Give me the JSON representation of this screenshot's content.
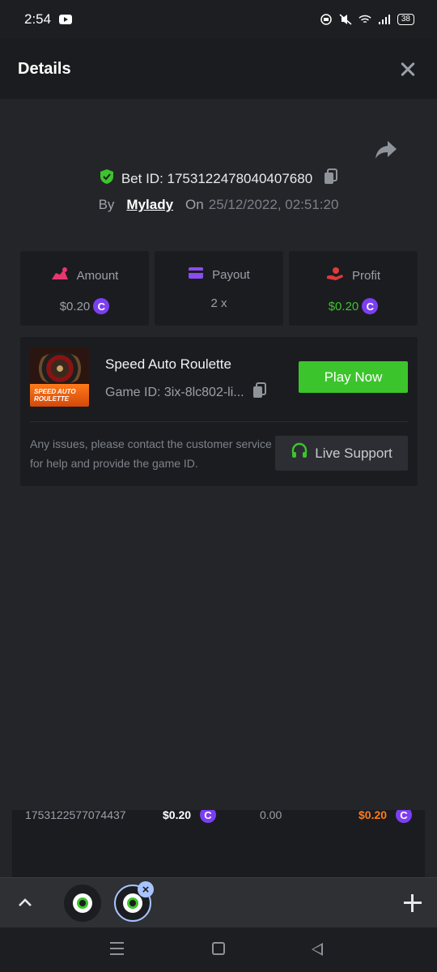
{
  "status_bar": {
    "time": "2:54",
    "battery": "38"
  },
  "header": {
    "title": "Details"
  },
  "bet": {
    "bet_id_label": "Bet ID: 1753122478040407680",
    "by_label": "By",
    "user": "Mylady",
    "on_label": "On",
    "datetime": "25/12/2022, 02:51:20"
  },
  "stats": {
    "amount": {
      "label": "Amount",
      "value": "$0.20"
    },
    "payout": {
      "label": "Payout",
      "value": "2 x"
    },
    "profit": {
      "label": "Profit",
      "value": "$0.20"
    },
    "coin_symbol": "C"
  },
  "game": {
    "thumb_title": "SPEED AUTO ROULETTE",
    "name": "Speed Auto Roulette",
    "game_id": "Game ID: 3ix-8lc802-li...",
    "play_label": "Play Now",
    "issue_text": "Any issues, please contact the customer service for help and provide the game ID.",
    "support_label": "Live Support"
  },
  "peek_rows": [
    {
      "id": "1753122577074437",
      "amount": "$0.20",
      "payout": "0.00",
      "profit": "$0.20"
    }
  ],
  "colors": {
    "accent_green": "#3cc42c",
    "coin_purple": "#7b3ff2",
    "amount_pink": "#e8366e",
    "payout_purple": "#8b4cf0",
    "profit_red": "#e03a3a"
  },
  "icons": [
    "close-icon",
    "share-icon",
    "shield-check-icon",
    "copy-icon",
    "amount-icon",
    "payout-card-icon",
    "profit-hand-icon",
    "headset-icon"
  ]
}
